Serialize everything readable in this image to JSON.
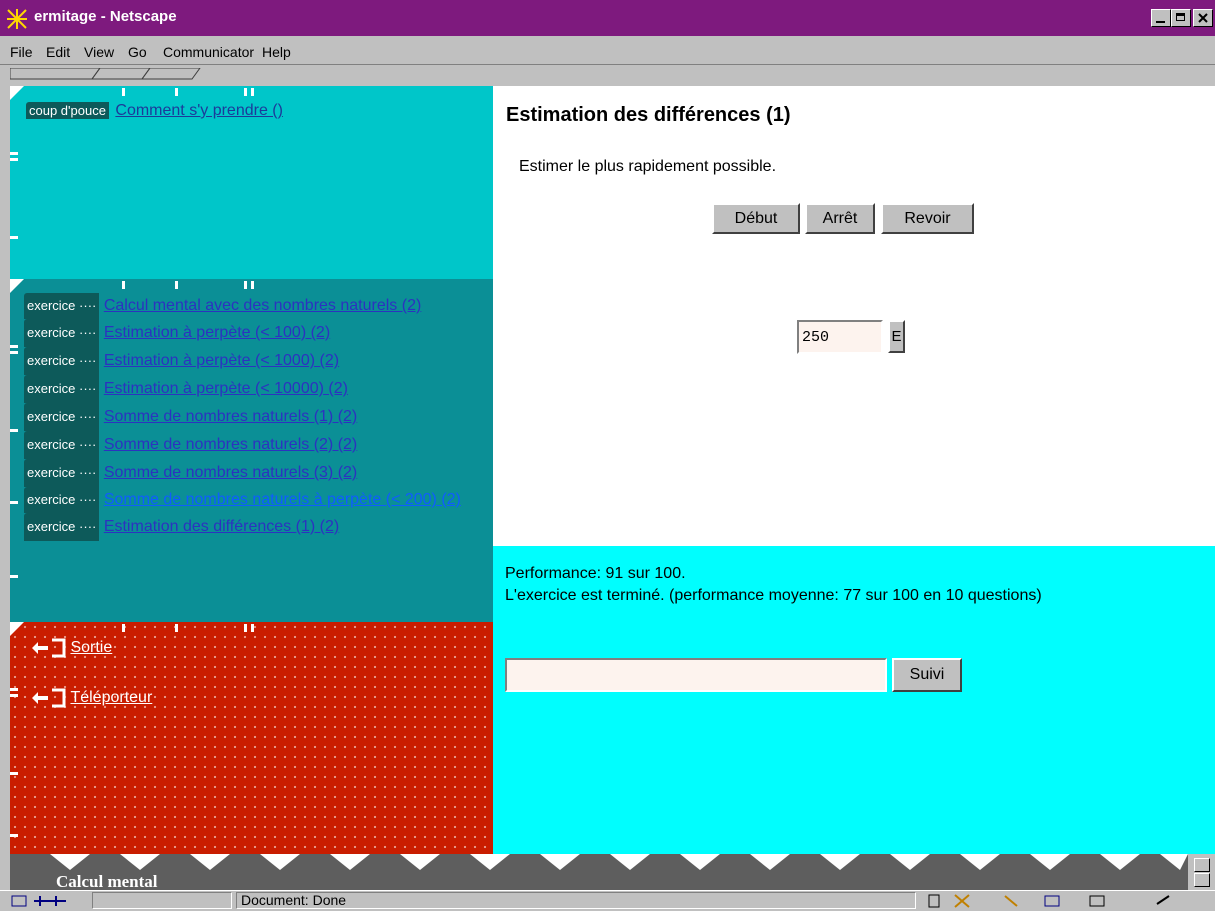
{
  "window": {
    "title": "ermitage - Netscape"
  },
  "menu": [
    "File",
    "Edit",
    "View",
    "Go",
    "Communicator",
    "Help"
  ],
  "help_frame": {
    "tag": "coup d'pouce",
    "link": "Comment s'y prendre ()"
  },
  "exercises": {
    "tag": "exercice",
    "items": [
      "Calcul mental avec des nombres naturels (2)",
      "Estimation à perpète (< 100) (2)",
      "Estimation à perpète (< 1000) (2)",
      "Estimation à perpète (< 10000) (2)",
      "Somme de nombres naturels (1) (2)",
      "Somme de nombres naturels (2) (2)",
      "Somme de nombres naturels (3) (2)",
      "Somme de nombres naturels à perpète (< 200) (2)",
      "Estimation des différences (1) (2)"
    ]
  },
  "exit_frame": {
    "items": [
      "Sortie",
      "Téléporteur"
    ]
  },
  "main": {
    "heading": "Estimation des différences (1)",
    "instruction": "Estimer le plus rapidement possible.",
    "buttons": {
      "start": "Début",
      "stop": "Arrêt",
      "review": "Revoir"
    },
    "answer_value": "250",
    "answer_button": "E"
  },
  "performance": {
    "line1": "Performance: 91 sur 100.",
    "line2": "L'exercice est terminé. (performance moyenne: 77 sur 100 en 10 questions)",
    "input_value": "",
    "next_button": "Suivi"
  },
  "footer": {
    "title": "Calcul mental"
  },
  "status": {
    "text": "Document: Done"
  },
  "colors": {
    "titlebar": "#7e1a7e",
    "help_bg": "#00c6c9",
    "exercise_bg": "#0b8f96",
    "exit_bg": "#c91d00",
    "perf_bg": "#00fefe"
  }
}
